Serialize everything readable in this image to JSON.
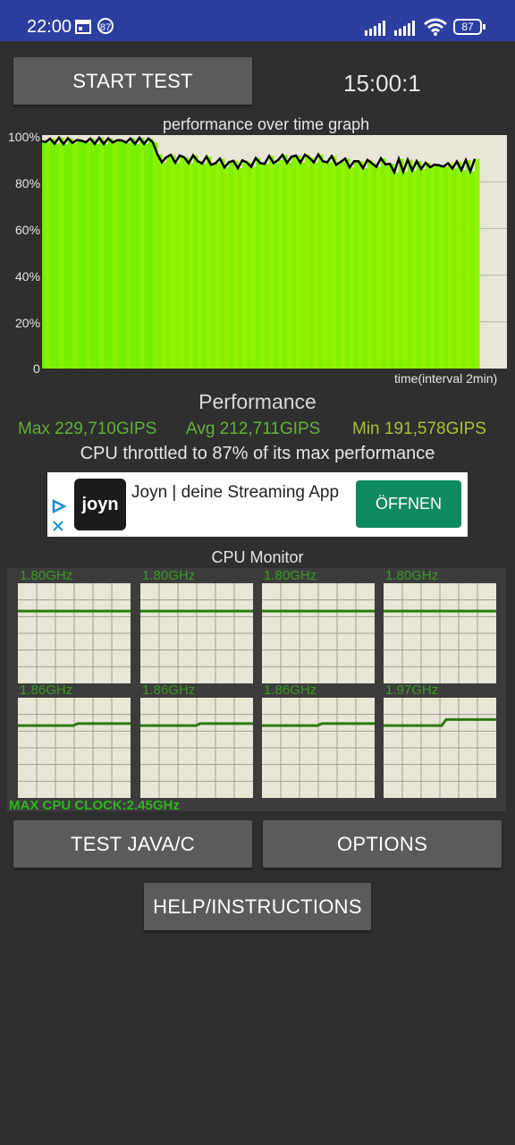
{
  "status_bar": {
    "time": "22:00",
    "notification_badge": "87",
    "battery": "87",
    "icons": [
      "calendar-icon",
      "notification-count-icon",
      "signal-icon",
      "signal-icon",
      "wifi-icon",
      "battery-icon"
    ]
  },
  "controls": {
    "start_test_label": "START TEST",
    "timer": "15:00:1",
    "test_java_label": "TEST JAVA/C",
    "options_label": "OPTIONS",
    "help_label": "HELP/INSTRUCTIONS"
  },
  "graph": {
    "title": "performance over time graph",
    "y_labels": [
      "100%",
      "80%",
      "60%",
      "40%",
      "20%",
      "0"
    ],
    "x_label": "time(interval 2min)"
  },
  "performance": {
    "title": "Performance",
    "max": "Max 229,710GIPS",
    "avg": "Avg 212,711GIPS",
    "min": "Min 191,578GIPS",
    "throttle": "CPU throttled to 87% of its max performance"
  },
  "ad": {
    "logo_text": "joyn",
    "text": "Joyn | deine Streaming App",
    "button": "ÖFFNEN"
  },
  "cpu_monitor": {
    "title": "CPU Monitor",
    "cores": [
      {
        "freq": "1.80GHz",
        "level_before": 0.74,
        "level_after": 0.74
      },
      {
        "freq": "1.80GHz",
        "level_before": 0.74,
        "level_after": 0.74
      },
      {
        "freq": "1.80GHz",
        "level_before": 0.74,
        "level_after": 0.74
      },
      {
        "freq": "1.80GHz",
        "level_before": 0.74,
        "level_after": 0.74
      },
      {
        "freq": "1.86GHz",
        "level_before": 0.74,
        "level_after": 0.76
      },
      {
        "freq": "1.86GHz",
        "level_before": 0.74,
        "level_after": 0.76
      },
      {
        "freq": "1.86GHz",
        "level_before": 0.74,
        "level_after": 0.76
      },
      {
        "freq": "1.97GHz",
        "level_before": 0.74,
        "level_after": 0.8
      }
    ],
    "max_clock": "MAX CPU CLOCK:2.45GHz"
  },
  "colors": {
    "status_bar": "#2c3fa0",
    "background": "#2f2f2f",
    "button": "#5b5b5b",
    "graph_green": "#7ef000",
    "graph_bg": "#e8e6d6",
    "stat_max": "#5fb23a",
    "stat_min": "#a7c23a",
    "ad_button": "#0f8a5f"
  }
}
